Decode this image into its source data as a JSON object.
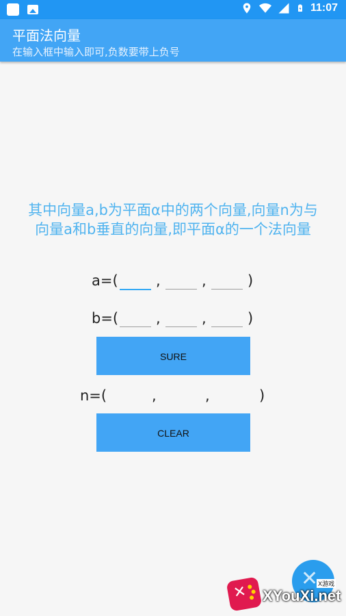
{
  "status_bar": {
    "time": "11:07",
    "left_icons": [
      "app-square-icon",
      "image-icon"
    ],
    "right_icons": [
      "location-icon",
      "wifi-icon",
      "signal-icon",
      "battery-icon"
    ]
  },
  "app_bar": {
    "title": "平面法向量",
    "subtitle": "在输入框中输入即可,负数要带上负号"
  },
  "description": {
    "line1": "其中向量a,b为平面α中的两个向量,向量n为与",
    "line2": "向量a和b垂直的向量,即平面α的一个法向量"
  },
  "vector_a": {
    "label": "a=(",
    "x": "",
    "y": "",
    "z": "",
    "sep": ",",
    "close": ")"
  },
  "vector_b": {
    "label": "b=(",
    "x": "",
    "y": "",
    "z": "",
    "sep": ",",
    "close": ")"
  },
  "sure_button": "SURE",
  "vector_n": {
    "label": "n=(",
    "x": "",
    "y": "",
    "z": "",
    "sep": ",",
    "close": ")"
  },
  "clear_button": "CLEAR",
  "watermark": {
    "text": "XYouXi.net",
    "small": "X游戏"
  },
  "colors": {
    "status_bar": "#2196f3",
    "app_bar": "#42a5f5",
    "accent_text": "#4fb3ef",
    "button": "#42a5f5"
  }
}
